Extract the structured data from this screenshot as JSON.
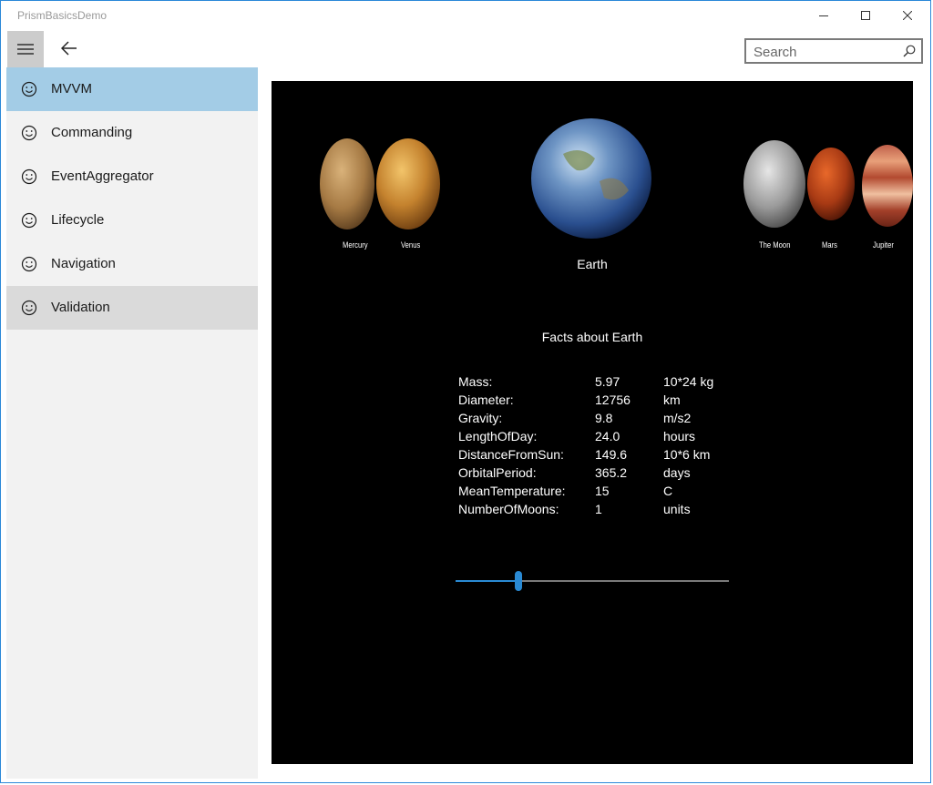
{
  "window": {
    "title": "PrismBasicsDemo",
    "minimize_icon": "minimize-icon",
    "maximize_icon": "maximize-icon",
    "close_icon": "close-icon"
  },
  "toolbar": {
    "menu_icon": "hamburger-icon",
    "back_icon": "back-arrow-icon"
  },
  "search": {
    "placeholder": "Search",
    "value": "",
    "icon": "search-icon"
  },
  "sidebar": {
    "items": [
      {
        "label": "MVVM",
        "icon": "smiley-icon",
        "state": "selected"
      },
      {
        "label": "Commanding",
        "icon": "smiley-icon",
        "state": "normal"
      },
      {
        "label": "EventAggregator",
        "icon": "smiley-icon",
        "state": "normal"
      },
      {
        "label": "Lifecycle",
        "icon": "smiley-icon",
        "state": "normal"
      },
      {
        "label": "Navigation",
        "icon": "smiley-icon",
        "state": "normal"
      },
      {
        "label": "Validation",
        "icon": "smiley-icon",
        "state": "hovered"
      }
    ]
  },
  "planets": {
    "mercury": "Mercury",
    "venus": "Venus",
    "moon": "The Moon",
    "mars": "Mars",
    "jupiter": "Jupiter",
    "selected": "Earth"
  },
  "facts": {
    "title": "Facts about Earth",
    "rows": [
      {
        "name": "Mass:",
        "value": "5.97",
        "unit": "10*24 kg"
      },
      {
        "name": "Diameter:",
        "value": "12756",
        "unit": "km"
      },
      {
        "name": "Gravity:",
        "value": "9.8",
        "unit": "m/s2"
      },
      {
        "name": "LengthOfDay:",
        "value": "24.0",
        "unit": "hours"
      },
      {
        "name": "DistanceFromSun:",
        "value": "149.6",
        "unit": "10*6 km"
      },
      {
        "name": "OrbitalPeriod:",
        "value": "365.2",
        "unit": "days"
      },
      {
        "name": "MeanTemperature:",
        "value": "15",
        "unit": "C"
      },
      {
        "name": "NumberOfMoons:",
        "value": "1",
        "unit": "units"
      }
    ]
  },
  "slider": {
    "value_fraction": 0.23
  },
  "colors": {
    "accent": "#2a8ad4",
    "selected_nav": "#a3cce6",
    "hover_nav": "#dadada",
    "sidebar_bg": "#f2f2f2",
    "canvas_bg": "#000000"
  }
}
